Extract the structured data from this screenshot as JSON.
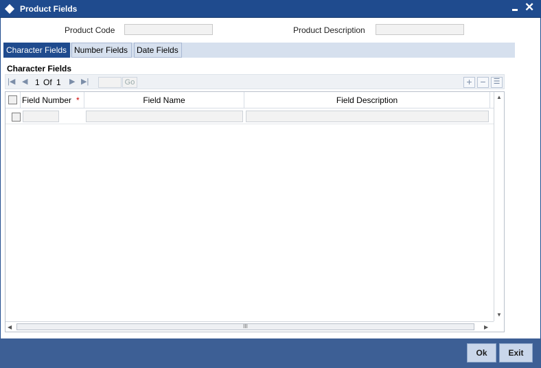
{
  "window": {
    "title": "Product Fields"
  },
  "header": {
    "product_code_label": "Product Code",
    "product_code_value": "",
    "product_description_label": "Product Description",
    "product_description_value": ""
  },
  "tabs": [
    {
      "label": "Character Fields",
      "active": true
    },
    {
      "label": "Number Fields",
      "active": false
    },
    {
      "label": "Date Fields",
      "active": false
    }
  ],
  "section": {
    "title": "Character Fields"
  },
  "pager": {
    "current": "1",
    "of_label": "Of",
    "total": "1",
    "go_label": "Go",
    "page_input": ""
  },
  "grid": {
    "columns": [
      "Field Number",
      "Field Name",
      "Field Description"
    ],
    "required_marker": "*",
    "rows": [
      {
        "field_number": "",
        "field_name": "",
        "field_description": ""
      }
    ]
  },
  "scroll": {
    "thumb_grip": "III"
  },
  "footer": {
    "ok_label": "Ok",
    "exit_label": "Exit"
  },
  "colors": {
    "titlebar": "#1f4b8e",
    "active_tab": "#1f4b8e",
    "footer": "#3d5f95",
    "required": "#d00000"
  }
}
